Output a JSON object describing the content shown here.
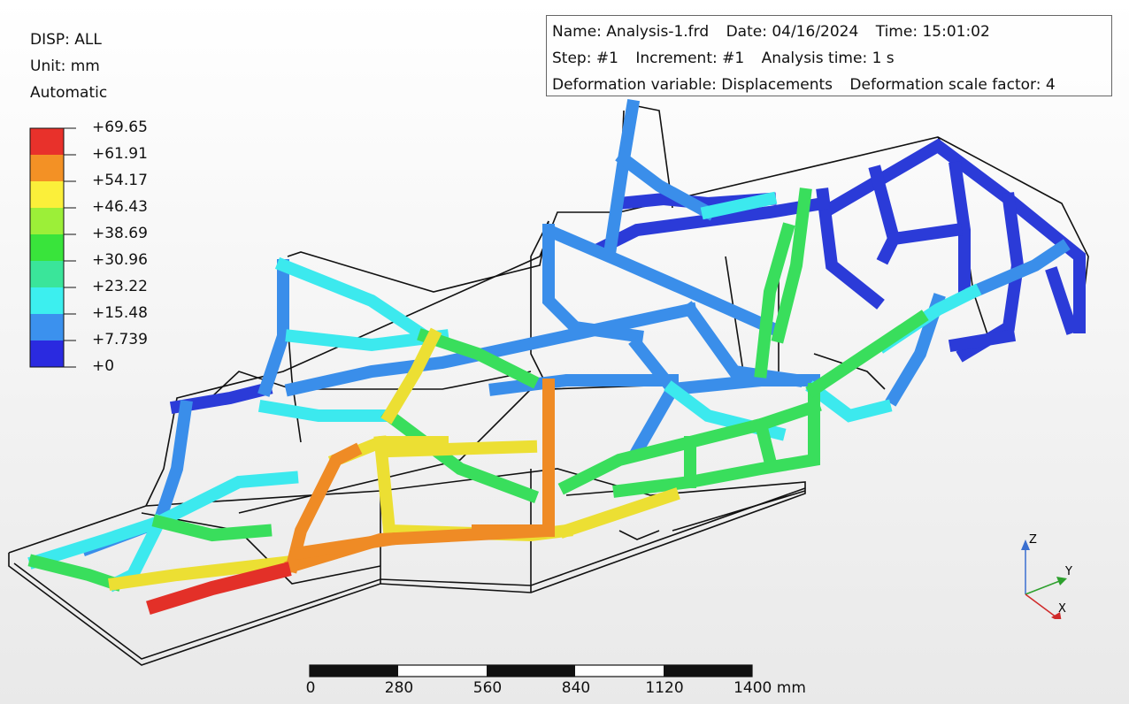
{
  "legend": {
    "title": "DISP: ALL",
    "unit": "Unit: mm",
    "mode": "Automatic",
    "ticks": [
      "+69.65",
      "+61.91",
      "+54.17",
      "+46.43",
      "+38.69",
      "+30.96",
      "+23.22",
      "+15.48",
      "+7.739",
      "+0"
    ],
    "colors": [
      "#e8312b",
      "#f39125",
      "#fbef3a",
      "#9cef38",
      "#39e43b",
      "#3ae59a",
      "#3cefef",
      "#3b91ee",
      "#2a2ae0"
    ]
  },
  "info": {
    "name": "Name: Analysis-1.frd",
    "date": "Date: 04/16/2024",
    "time": "Time: 15:01:02",
    "step": "Step: #1",
    "increment": "Increment: #1",
    "analysis_time": "Analysis time: 1 s",
    "deformation_variable": "Deformation variable: Displacements",
    "deformation_scale": "Deformation scale factor: 4"
  },
  "scale_bar": {
    "labels": [
      "0",
      "280",
      "560",
      "840",
      "1120",
      "1400 mm"
    ]
  },
  "triad": {
    "z": "Z",
    "y": "Y",
    "x": "X",
    "z_color": "#3a6fd0",
    "y_color": "#2da02d",
    "x_color": "#d02a2a"
  }
}
